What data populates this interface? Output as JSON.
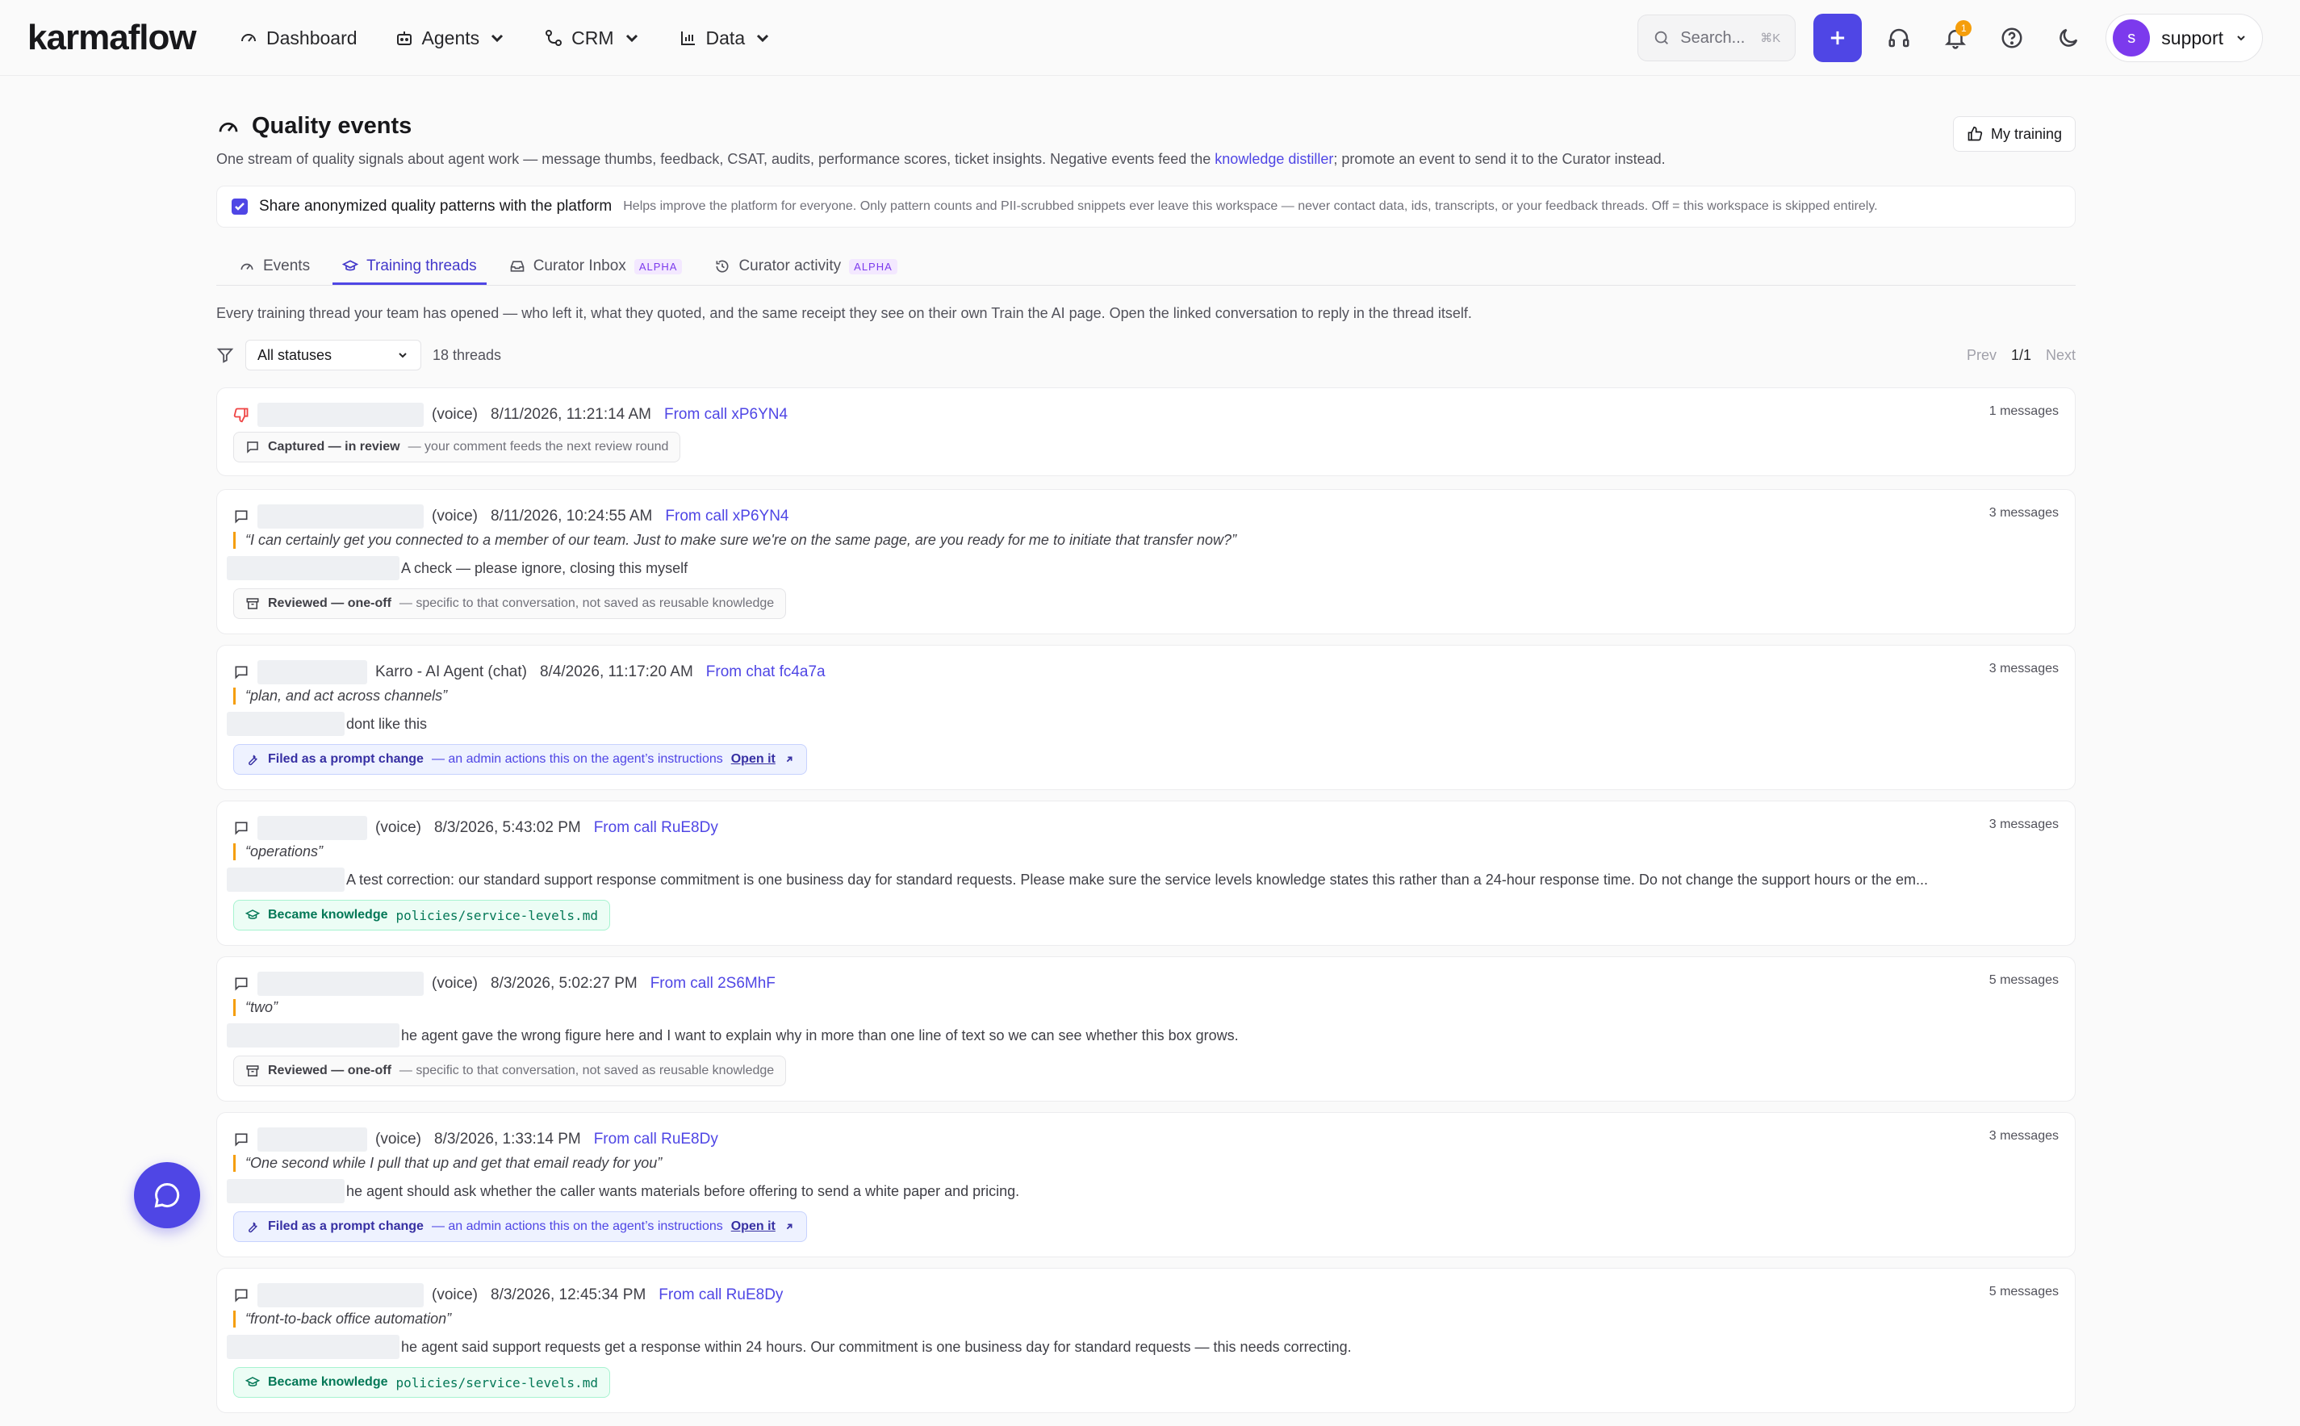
{
  "app": {
    "logo_text": "karmaflow",
    "nav": [
      {
        "label": "Dashboard"
      },
      {
        "label": "Agents"
      },
      {
        "label": "CRM"
      },
      {
        "label": "Data"
      }
    ],
    "search_placeholder": "Search...",
    "search_shortcut": "⌘K",
    "notification_count": "1",
    "user_initial": "s",
    "user_name": "support",
    "accent_color": "#4f46e5"
  },
  "page": {
    "title": "Quality events",
    "subtitle_pre": "One stream of quality signals about agent work — message thumbs, feedback, CSAT, audits, performance scores, ticket insights. Negative events feed the ",
    "subtitle_link": "knowledge distiller",
    "subtitle_post": "; promote an event to send it to the Curator instead.",
    "my_training_label": "My training",
    "share_label": "Share anonymized quality patterns with the platform",
    "share_help": "Helps improve the platform for everyone. Only pattern counts and PII-scrubbed snippets ever leave this workspace — never contact data, ids, transcripts, or your feedback threads. Off = this workspace is skipped entirely.",
    "share_checked": true,
    "tabs": [
      {
        "label": "Events",
        "active": false
      },
      {
        "label": "Training threads",
        "active": true
      },
      {
        "label": "Curator Inbox",
        "badge": "ALPHA",
        "active": false
      },
      {
        "label": "Curator activity",
        "badge": "ALPHA",
        "active": false
      }
    ],
    "intro": "Every training thread your team has opened — who left it, what they quoted, and the same receipt they see on their own Train the AI page. Open the linked conversation to reply in the thread itself.",
    "filter_value": "All statuses",
    "thread_count": "18 threads",
    "pager_prev": "Prev",
    "pager_page": "1/1",
    "pager_next": "Next"
  },
  "threads": [
    {
      "channel": "(voice)",
      "time": "8/11/2026, 11:21:14 AM",
      "source": "From call xP6YN4",
      "messages": "1 messages",
      "status_title": "Captured — in review",
      "status_desc": "— your comment feeds the next review round"
    },
    {
      "channel": "(voice)",
      "time": "8/11/2026, 10:24:55 AM",
      "source": "From call xP6YN4",
      "messages": "3 messages",
      "quote": "“I can certainly get you connected to a member of our team. Just to make sure we're on the same page, are you ready for me to initiate that transfer now?”",
      "comment": "A check — please ignore, closing this myself",
      "status_title": "Reviewed — one-off",
      "status_desc": "— specific to that conversation, not saved as reusable knowledge"
    },
    {
      "channel": "Karro - AI Agent (chat)",
      "time": "8/4/2026, 11:17:20 AM",
      "source": "From chat fc4a7a",
      "messages": "3 messages",
      "quote": "“plan, and act across channels”",
      "comment": "dont like this",
      "status_title": "Filed as a prompt change",
      "status_desc": "— an admin actions this on the agent’s instructions",
      "status_link": "Open it"
    },
    {
      "channel": "(voice)",
      "time": "8/3/2026, 5:43:02 PM",
      "source": "From call RuE8Dy",
      "messages": "3 messages",
      "quote": "“operations”",
      "comment": "A test correction: our standard support response commitment is one business day for standard requests. Please make sure the service levels knowledge states this rather than a 24-hour response time. Do not change the support hours or the em...",
      "status_title": "Became knowledge",
      "status_path": "policies/service-levels.md"
    },
    {
      "channel": "(voice)",
      "time": "8/3/2026, 5:02:27 PM",
      "source": "From call 2S6MhF",
      "messages": "5 messages",
      "quote": "“two”",
      "comment": "he agent gave the wrong figure here and I want to explain why in more than one line of text so we can see whether this box grows.",
      "status_title": "Reviewed — one-off",
      "status_desc": "— specific to that conversation, not saved as reusable knowledge"
    },
    {
      "channel": "(voice)",
      "time": "8/3/2026, 1:33:14 PM",
      "source": "From call RuE8Dy",
      "messages": "3 messages",
      "quote": "“One second while I pull that up and get that email ready for you”",
      "comment": "he agent should ask whether the caller wants materials before offering to send a white paper and pricing.",
      "status_title": "Filed as a prompt change",
      "status_desc": "— an admin actions this on the agent’s instructions",
      "status_link": "Open it"
    },
    {
      "channel": "(voice)",
      "time": "8/3/2026, 12:45:34 PM",
      "source": "From call RuE8Dy",
      "messages": "5 messages",
      "quote": "“front-to-back office automation”",
      "comment": "he agent said support requests get a response within 24 hours. Our commitment is one business day for standard requests — this needs correcting.",
      "status_title": "Became knowledge",
      "status_path": "policies/service-levels.md"
    }
  ]
}
